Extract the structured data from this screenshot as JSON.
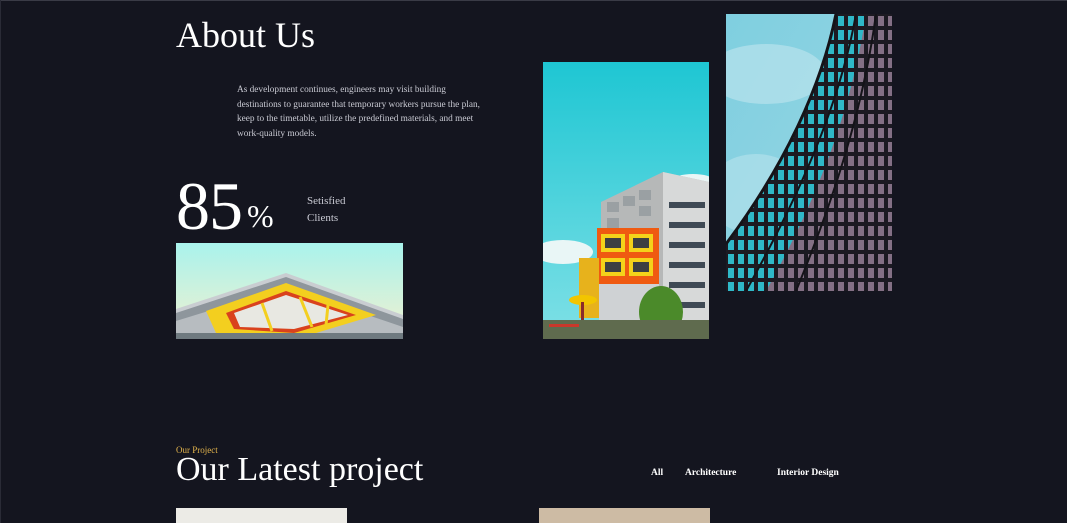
{
  "about": {
    "title": "About Us",
    "description": "As development continues, engineers may visit building destinations to guarantee that temporary workers pursue the plan, keep to the timetable, utilize the predefined materials, and meet work-quality models.",
    "stat_value": "85",
    "stat_unit": "%",
    "stat_label": "Setisfied Clients"
  },
  "projects": {
    "eyebrow": "Our Project",
    "title": "Our Latest project",
    "filters": [
      "All",
      "Architecture",
      "Interior Design"
    ]
  },
  "colors": {
    "background": "#14151f",
    "accent": "#e3b44c"
  }
}
